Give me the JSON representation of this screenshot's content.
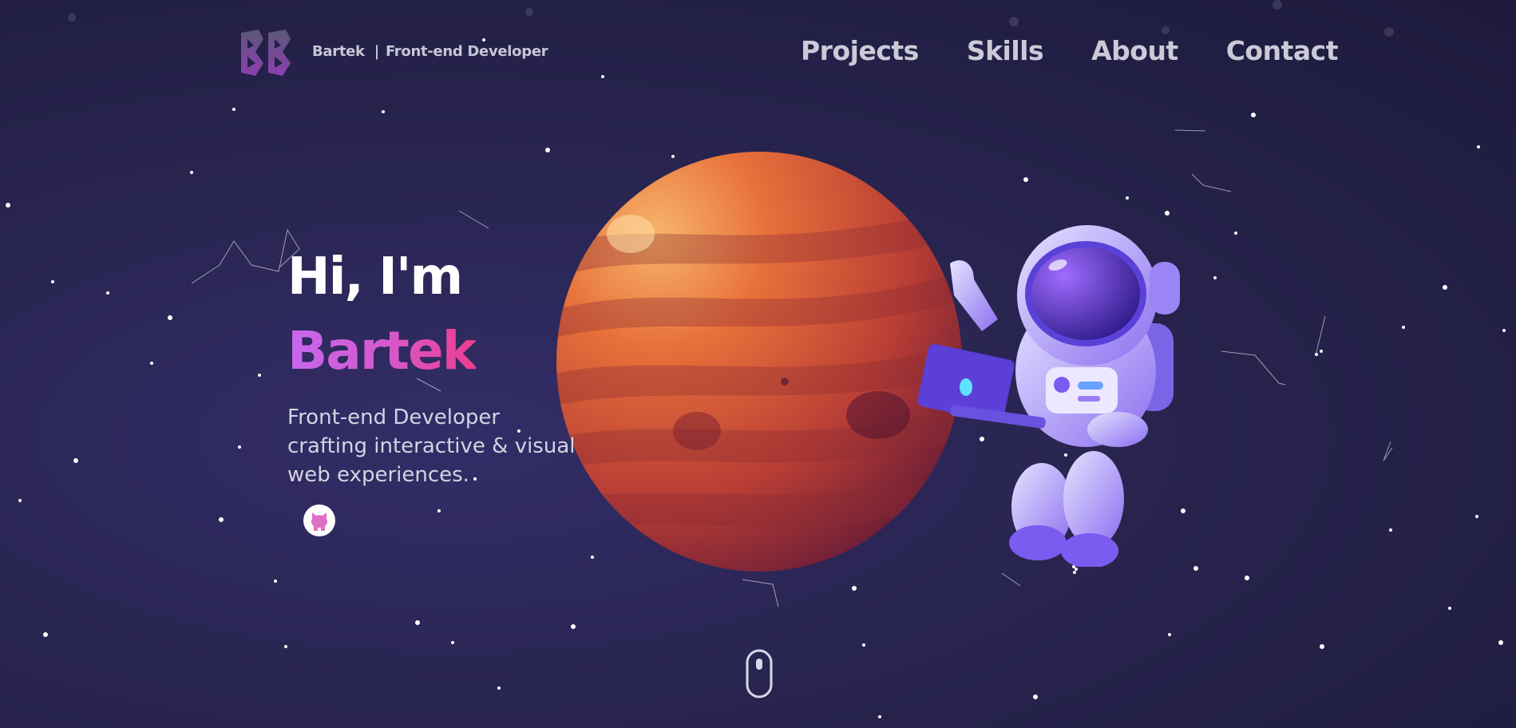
{
  "header": {
    "logo_icon": "bb-monogram-logo",
    "brand_name": "Bartek",
    "brand_sep": "|",
    "brand_role": "Front-end Developer",
    "nav": [
      {
        "label": "Projects"
      },
      {
        "label": "Skills"
      },
      {
        "label": "About"
      },
      {
        "label": "Contact"
      }
    ]
  },
  "hero": {
    "greeting": "Hi, I'm",
    "name": "Bartek",
    "tagline_lines": [
      "Front-end Developer",
      "crafting interactive & visual",
      "web experiences."
    ],
    "github_icon": "github-icon"
  },
  "illustration": {
    "planet": "planet",
    "astronaut": "astronaut-with-laptop"
  },
  "scroll_icon": "mouse-scroll-icon",
  "colors": {
    "background": "#28244f",
    "accent_start": "#c568f0",
    "accent_end": "#ec3d8f",
    "nav_text": "#cbcad7",
    "planet": "#d05a3c"
  }
}
